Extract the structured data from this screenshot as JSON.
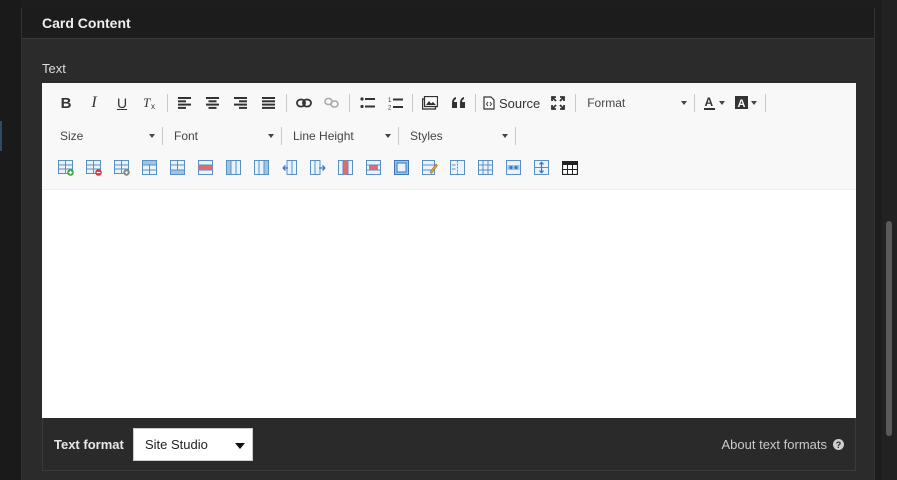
{
  "panel": {
    "title": "Card Content"
  },
  "field": {
    "label": "Text"
  },
  "toolbar": {
    "row1": {
      "bold": "B",
      "italic": "I",
      "underline": "U",
      "remove_format": "Tx",
      "source_label": "Source",
      "format_label": "Format",
      "text_color_letter": "A",
      "bg_color_letter": "A"
    },
    "row2": {
      "size_label": "Size",
      "font_label": "Font",
      "line_height_label": "Line Height",
      "styles_label": "Styles"
    }
  },
  "text_format": {
    "label": "Text format",
    "selected": "Site Studio",
    "about_link": "About text formats",
    "help_glyph": "?"
  }
}
